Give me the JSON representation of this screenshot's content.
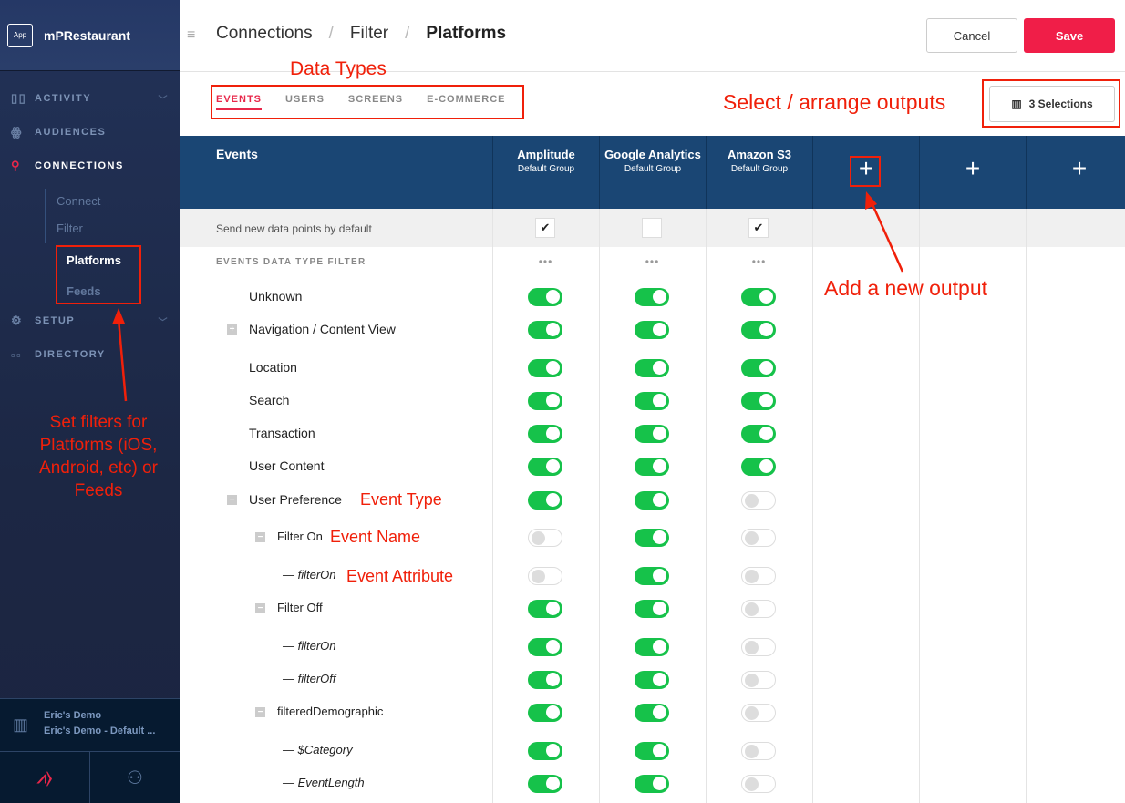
{
  "sidebar": {
    "app_logo": "App",
    "app_name": "mPRestaurant",
    "nav": [
      {
        "label": "ACTIVITY",
        "icon": "bar-chart-icon"
      },
      {
        "label": "AUDIENCES",
        "icon": "people-icon"
      },
      {
        "label": "CONNECTIONS",
        "icon": "connections-icon",
        "active": true
      },
      {
        "label": "SETUP",
        "icon": "gear-icon"
      },
      {
        "label": "DIRECTORY",
        "icon": "grid-icon"
      }
    ],
    "sub": [
      "Connect",
      "Filter"
    ],
    "sub2": [
      "Platforms",
      "Feeds"
    ],
    "account": {
      "name": "Eric's Demo",
      "workspace": "Eric's Demo - Default ..."
    }
  },
  "header": {
    "crumbs": [
      "Connections",
      "Filter",
      "Platforms"
    ],
    "cancel": "Cancel",
    "save": "Save"
  },
  "tabs": [
    "EVENTS",
    "USERS",
    "SCREENS",
    "E-COMMERCE"
  ],
  "selections": "3 Selections",
  "table": {
    "title": "Events",
    "outputs": [
      {
        "name": "Amplitude",
        "group": "Default Group"
      },
      {
        "name": "Google Analytics",
        "group": "Default Group"
      },
      {
        "name": "Amazon S3",
        "group": "Default Group"
      }
    ],
    "add_slots": 3,
    "default_label": "Send new data points by default",
    "defaults": [
      true,
      false,
      true
    ],
    "filter_title": "EVENTS DATA TYPE FILTER",
    "rows": [
      {
        "label": "Unknown",
        "level": 0,
        "on": [
          true,
          true,
          true
        ]
      },
      {
        "label": "Navigation / Content View",
        "level": 0,
        "expander": "+",
        "on": [
          true,
          true,
          true
        ]
      },
      {
        "label": "Location",
        "level": 0,
        "on": [
          true,
          true,
          true
        ]
      },
      {
        "label": "Search",
        "level": 0,
        "on": [
          true,
          true,
          true
        ]
      },
      {
        "label": "Transaction",
        "level": 0,
        "on": [
          true,
          true,
          true
        ]
      },
      {
        "label": "User Content",
        "level": 0,
        "on": [
          true,
          true,
          true
        ]
      },
      {
        "label": "User Preference",
        "level": 0,
        "expander": "−",
        "on": [
          true,
          true,
          false
        ]
      },
      {
        "label": "Filter On",
        "level": 1,
        "expander": "−",
        "on": [
          false,
          true,
          false
        ]
      },
      {
        "label": "— filterOn",
        "level": 2,
        "on": [
          false,
          true,
          false
        ]
      },
      {
        "label": "Filter Off",
        "level": 1,
        "expander": "−",
        "on": [
          true,
          true,
          false
        ]
      },
      {
        "label": "— filterOn",
        "level": 2,
        "on": [
          true,
          true,
          false
        ]
      },
      {
        "label": "— filterOff",
        "level": 2,
        "on": [
          true,
          true,
          false
        ]
      },
      {
        "label": "filteredDemographic",
        "level": 1,
        "expander": "−",
        "on": [
          true,
          true,
          false
        ]
      },
      {
        "label": "— $Category",
        "level": 2,
        "on": [
          true,
          true,
          false
        ]
      },
      {
        "label": "— EventLength",
        "level": 2,
        "on": [
          true,
          true,
          false
        ]
      }
    ]
  },
  "annotations": {
    "data_types": "Data Types",
    "select_outputs": "Select / arrange outputs",
    "add_output": "Add a new output",
    "set_filters": "Set filters for Platforms (iOS, Android, etc) or Feeds",
    "event_type": "Event Type",
    "event_name": "Event Name",
    "event_attribute": "Event Attribute"
  },
  "colors": {
    "accent": "#e8274a",
    "header": "#1a4674",
    "toggle_on": "#16c24a",
    "annotation": "#f0200a"
  }
}
